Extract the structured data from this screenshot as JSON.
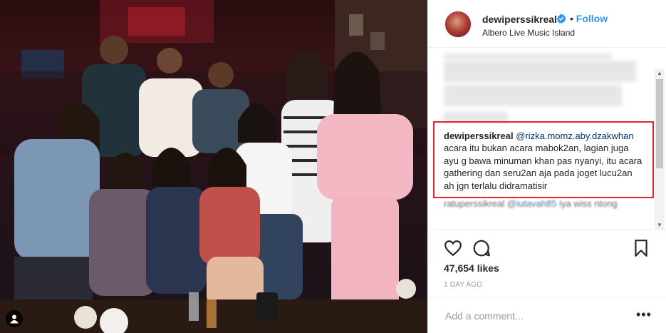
{
  "post": {
    "username": "dewiperssikreal",
    "verified": true,
    "follow_separator": "•",
    "follow_label": "Follow",
    "location": "Albero Live Music Island"
  },
  "comments": {
    "highlighted": {
      "username": "dewiperssikreal",
      "mention": "@rizka.momz.aby.dzakwhan",
      "text": " acara itu bukan acara mabok2an, lagian juga ayu g bawa minuman khan pas nyanyi, itu acara gathering dan seru2an aja pada joget lucu2an ah jgn terlalu didramatisir"
    },
    "next": {
      "username": "ratuperssikreal",
      "mention": "@iutavah85",
      "text": " iya wiss ntong"
    }
  },
  "stats": {
    "likes": "47,654 likes",
    "date": "1 DAY AGO"
  },
  "add_comment": {
    "placeholder": "Add a comment...",
    "more_label": "•••"
  },
  "icons": {
    "like": "heart-icon",
    "comment": "comment-bubble-icon",
    "save": "bookmark-icon",
    "verified": "verified-badge-icon",
    "user_tag": "user-tag-icon"
  },
  "colors": {
    "link_blue": "#3897f0",
    "mention": "#003569",
    "highlight_border": "#e0262a"
  }
}
